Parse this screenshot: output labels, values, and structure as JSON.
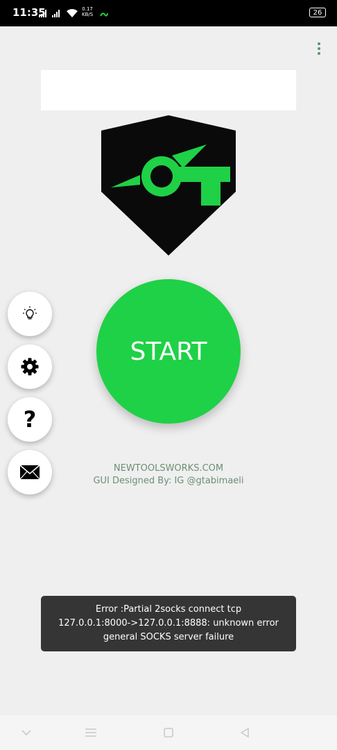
{
  "status_bar": {
    "time": "11:35",
    "net_speed_value": "0.17",
    "net_speed_unit": "KB/S",
    "battery": "26"
  },
  "app": {
    "start_label": "START",
    "website": "NEWTOOLSWORKS.COM",
    "designer_credit": "GUI  Designed By: IG @gtabimaeli"
  },
  "side_buttons": [
    {
      "name": "tips",
      "icon": "lightbulb-icon"
    },
    {
      "name": "settings",
      "icon": "gear-icon"
    },
    {
      "name": "help",
      "icon": "question-mark-icon"
    },
    {
      "name": "contact",
      "icon": "envelope-icon"
    }
  ],
  "toast": {
    "line1": "Error :Partial 2socks connect tcp",
    "line2": "127.0.0.1:8000->127.0.0.1:8888: unknown error",
    "line3": "general SOCKS server failure"
  },
  "colors": {
    "accent": "#1fd146",
    "logo_bg": "#0a0a0a",
    "toast_bg": "#353535",
    "credit_text": "#6b8f75"
  }
}
